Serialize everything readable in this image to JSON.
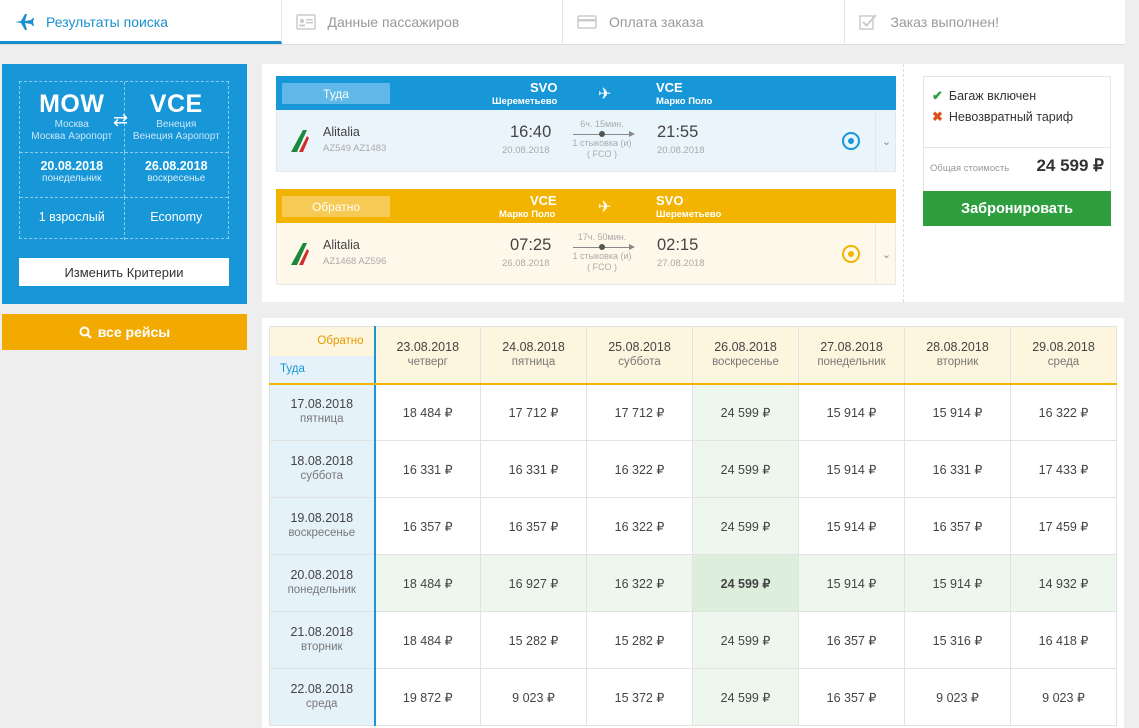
{
  "steps": [
    {
      "label": "Результаты поиска",
      "icon": "plane-icon",
      "active": true
    },
    {
      "label": "Данные пассажиров",
      "icon": "id-card-icon",
      "active": false
    },
    {
      "label": "Оплата заказа",
      "icon": "credit-card-icon",
      "active": false
    },
    {
      "label": "Заказ выполнен!",
      "icon": "checkbox-icon",
      "active": false
    }
  ],
  "criteria": {
    "from_code": "MOW",
    "from_city": "Москва",
    "from_airport": "Москва Аэропорт",
    "to_code": "VCE",
    "to_city": "Венеция",
    "to_airport": "Венеция Аэропорт",
    "depart_date": "20.08.2018",
    "depart_day": "понедельник",
    "return_date": "26.08.2018",
    "return_day": "воскресенье",
    "passengers": "1 взрослый",
    "cabin": "Economy",
    "change_label": "Изменить Критерии"
  },
  "all_flights_label": "все рейсы",
  "outbound": {
    "tag": "Туда",
    "from_code": "SVO",
    "from_name": "Шереметьево",
    "to_code": "VCE",
    "to_name": "Марко Поло",
    "airline": "Alitalia",
    "flight_numbers": "AZ549  AZ1483",
    "dep_time": "16:40",
    "dep_date": "20.08.2018",
    "duration": "6ч. 15мин.",
    "stops": "1 стыковка (и)",
    "via": "( FCO )",
    "arr_time": "21:55",
    "arr_date": "20.08.2018"
  },
  "inbound": {
    "tag": "Обратно",
    "from_code": "VCE",
    "from_name": "Марко Поло",
    "to_code": "SVO",
    "to_name": "Шереметьево",
    "airline": "Alitalia",
    "flight_numbers": "AZ1468  AZ596",
    "dep_time": "07:25",
    "dep_date": "26.08.2018",
    "duration": "17ч. 50мин.",
    "stops": "1 стыковка (и)",
    "via": "( FCO )",
    "arr_time": "02:15",
    "arr_date": "27.08.2018"
  },
  "fare": {
    "baggage": "Багаж включен",
    "refund": "Невозвратный тариф",
    "total_label": "Общая стоимость",
    "total_value": "24 599 ₽",
    "book_label": "Забронировать"
  },
  "matrix": {
    "back_label": "Обратно",
    "forward_label": "Туда",
    "columns": [
      {
        "date": "23.08.2018",
        "day": "четверг"
      },
      {
        "date": "24.08.2018",
        "day": "пятница"
      },
      {
        "date": "25.08.2018",
        "day": "суббота"
      },
      {
        "date": "26.08.2018",
        "day": "воскресенье"
      },
      {
        "date": "27.08.2018",
        "day": "понедельник"
      },
      {
        "date": "28.08.2018",
        "day": "вторник"
      },
      {
        "date": "29.08.2018",
        "day": "среда"
      }
    ],
    "rows": [
      {
        "date": "17.08.2018",
        "day": "пятница",
        "prices": [
          "18 484 ₽",
          "17 712 ₽",
          "17 712 ₽",
          "24 599 ₽",
          "15 914 ₽",
          "15 914 ₽",
          "16 322 ₽"
        ]
      },
      {
        "date": "18.08.2018",
        "day": "суббота",
        "prices": [
          "16 331 ₽",
          "16 331 ₽",
          "16 322 ₽",
          "24 599 ₽",
          "15 914 ₽",
          "16 331 ₽",
          "17 433 ₽"
        ]
      },
      {
        "date": "19.08.2018",
        "day": "воскресенье",
        "prices": [
          "16 357 ₽",
          "16 357 ₽",
          "16 322 ₽",
          "24 599 ₽",
          "15 914 ₽",
          "16 357 ₽",
          "17 459 ₽"
        ]
      },
      {
        "date": "20.08.2018",
        "day": "понедельник",
        "prices": [
          "18 484 ₽",
          "16 927 ₽",
          "16 322 ₽",
          "24 599 ₽",
          "15 914 ₽",
          "15 914 ₽",
          "14 932 ₽"
        ]
      },
      {
        "date": "21.08.2018",
        "day": "вторник",
        "prices": [
          "18 484 ₽",
          "15 282 ₽",
          "15 282 ₽",
          "24 599 ₽",
          "16 357 ₽",
          "15 316 ₽",
          "16 418 ₽"
        ]
      },
      {
        "date": "22.08.2018",
        "day": "среда",
        "prices": [
          "19 872 ₽",
          "9 023 ₽",
          "15 372 ₽",
          "24 599 ₽",
          "16 357 ₽",
          "9 023 ₽",
          "9 023 ₽"
        ]
      }
    ]
  }
}
